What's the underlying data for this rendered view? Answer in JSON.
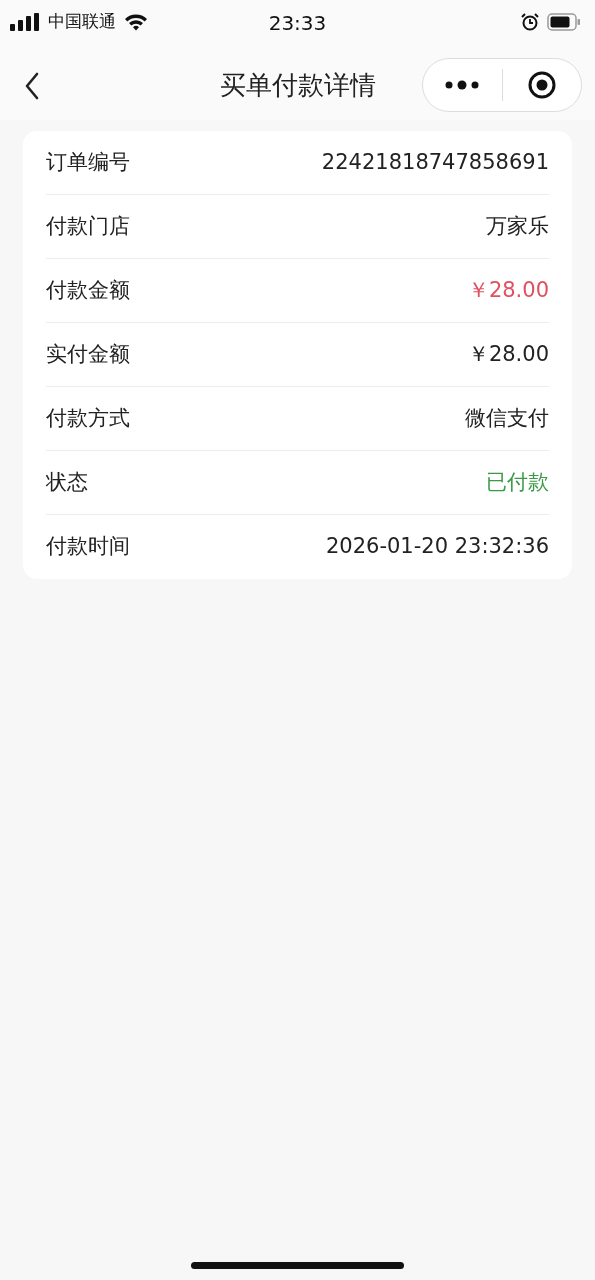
{
  "status_bar": {
    "carrier": "中国联通",
    "time": "23:33"
  },
  "nav": {
    "title": "买单付款详情"
  },
  "rows": [
    {
      "label": "订单编号",
      "value": "22421818747858691",
      "color": "#222222"
    },
    {
      "label": "付款门店",
      "value": "万家乐",
      "color": "#222222"
    },
    {
      "label": "付款金额",
      "value": "￥28.00",
      "color": "#e0505f"
    },
    {
      "label": "实付金额",
      "value": "￥28.00",
      "color": "#222222"
    },
    {
      "label": "付款方式",
      "value": "微信支付",
      "color": "#222222"
    },
    {
      "label": "状态",
      "value": "已付款",
      "color": "#3a9a45"
    },
    {
      "label": "付款时间",
      "value": "2026-01-20 23:32:36",
      "color": "#222222"
    }
  ]
}
